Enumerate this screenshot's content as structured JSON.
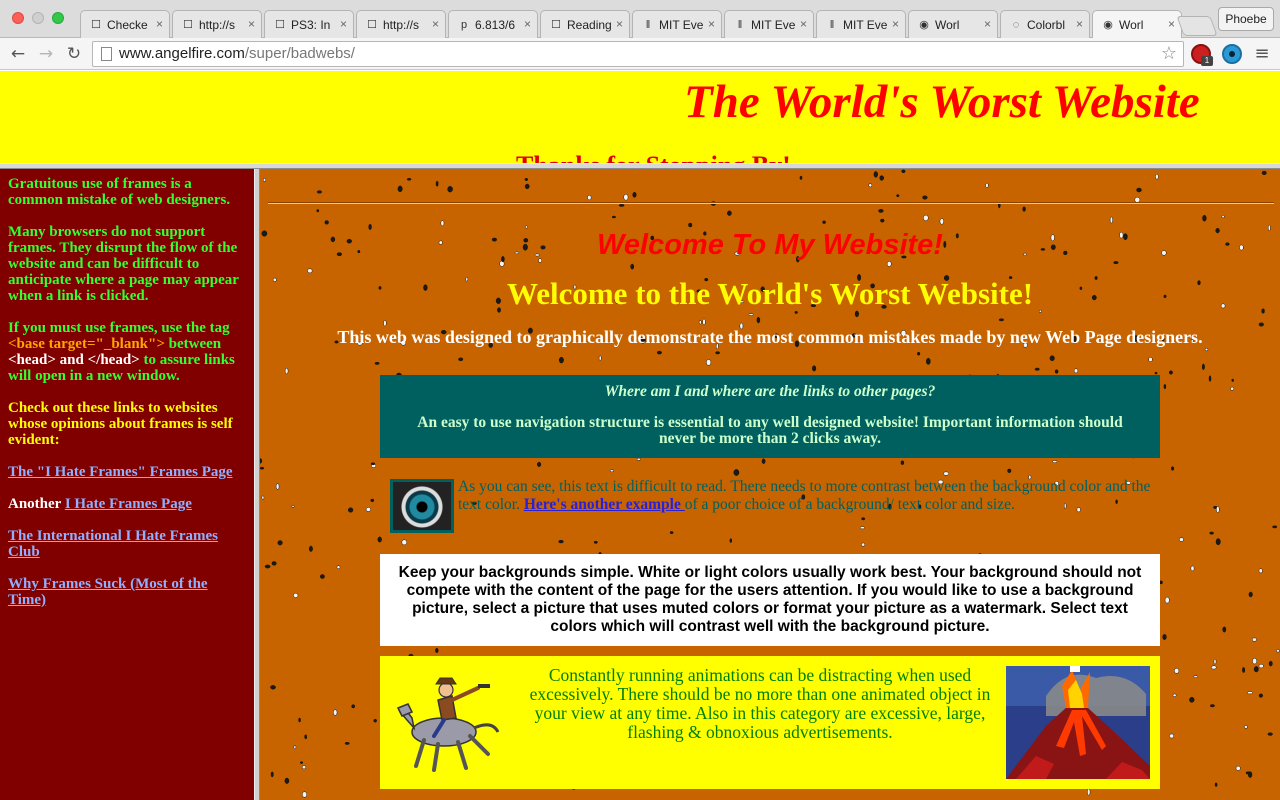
{
  "browser": {
    "tabs": [
      {
        "title": "Checke",
        "icon": "page-icon",
        "active": false
      },
      {
        "title": "http://s",
        "icon": "page-icon",
        "active": false
      },
      {
        "title": "PS3: In",
        "icon": "page-icon",
        "active": false
      },
      {
        "title": "http://s",
        "icon": "page-icon",
        "active": false
      },
      {
        "title": "6.813/6",
        "icon": "p-logo-icon",
        "active": false
      },
      {
        "title": "Reading",
        "icon": "page-icon",
        "active": false
      },
      {
        "title": "MIT Eve",
        "icon": "mit-logo-icon",
        "active": false
      },
      {
        "title": "MIT Eve",
        "icon": "mit-logo-icon",
        "active": false
      },
      {
        "title": "MIT Eve",
        "icon": "mit-logo-icon",
        "active": false
      },
      {
        "title": "Worl",
        "icon": "eye-icon",
        "active": false
      },
      {
        "title": "Colorbl",
        "icon": "loading-icon",
        "active": false
      },
      {
        "title": "Worl",
        "icon": "eye-icon",
        "active": true
      }
    ],
    "profile_name": "Phoebe",
    "url_host": "www.angelfire.com",
    "url_path": "/super/badwebs/",
    "extension_badge": "1"
  },
  "top_frame": {
    "title": "The World's Worst Website",
    "marquee_text": "Thanks for Stopping By!"
  },
  "left_frame": {
    "p1": "Gratuitous use of frames is a common mistake of web designers.",
    "p2": "Many browsers do not support frames. They disrupt the flow of the website and can be difficult to anticipate where a page may appear when a link is clicked.",
    "p3_before": "If you must use frames, use the tag ",
    "p3_code": "<base target=\"_blank\">",
    "p3_mid": " between ",
    "p3_head": "<head> and </head>",
    "p3_after": " to assure links will open in a new window.",
    "p4": "Check out these links to websites whose opinions about frames is self evident:",
    "link1": "The \"I Hate Frames\" Frames Page",
    "another_label": "Another",
    "link2": "I Hate Frames Page",
    "link3": "The International I Hate Frames Club",
    "link4": "Why Frames Suck (Most of the Time)"
  },
  "main": {
    "welcome1": "Welcome To My Website!",
    "welcome2": "Welcome to the World's Worst Website!",
    "intro": "This web was designed to graphically demonstrate the most common mistakes made by new Web Page designers.",
    "nav_question": "Where am I and where are the links to other pages?",
    "nav_answer": "An easy to use navigation structure is essential to any well designed website! Important information should never be more than 2 clicks away.",
    "contrast_text_1": "As you can see, this text is difficult to read. There needs to more contrast between the background color and the text color. ",
    "contrast_link": "Here's another example ",
    "contrast_text_2": "of a poor choice of a background/ text color and size.",
    "background_advice": "Keep your backgrounds simple. White or light colors usually work best. Your background should not compete with the content of the page for the users attention. If you would like to use a background picture, select a picture that uses muted colors or format your picture as a watermark. Select text colors which will contrast well with the background picture.",
    "animation_advice": "Constantly running animations can be distracting when used excessively. There should be no more than one animated object in your view at any time. Also in this category are excessive, large, flashing & obnoxious advertisements."
  },
  "colors": {
    "top_frame_bg": "#ffff00",
    "title_red": "#ff0000",
    "left_frame_bg": "#800000",
    "main_bg": "#c86400",
    "nav_box_bg": "#006060"
  }
}
